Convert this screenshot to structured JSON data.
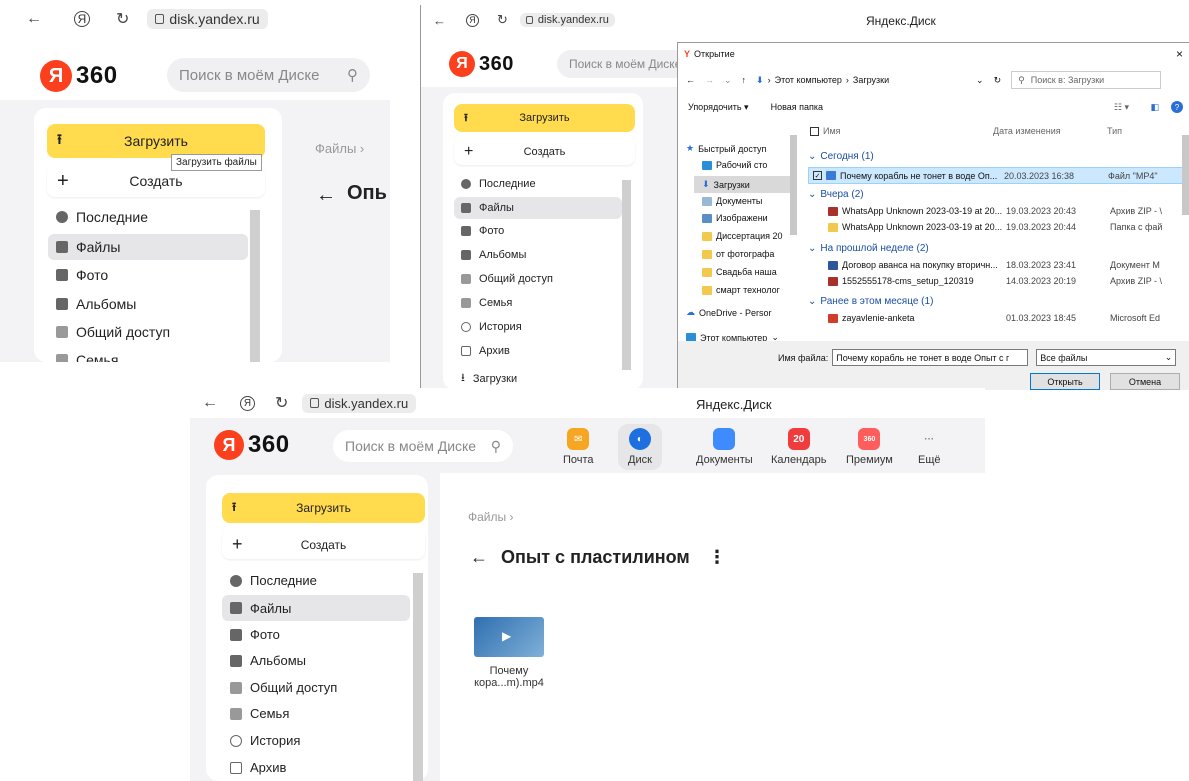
{
  "browser": {
    "url": "disk.yandex.ru",
    "page_title": "Яндекс.Диск"
  },
  "brand": {
    "logo_letter": "Я",
    "logo_text": "360",
    "accent": "#fc3f1d",
    "upload_color": "#ffdb4d"
  },
  "search": {
    "placeholder": "Поиск в моём Диске"
  },
  "sidebar": {
    "upload": "Загрузить",
    "create": "Создать",
    "items": [
      {
        "label": "Последние",
        "icon": "clock-icon"
      },
      {
        "label": "Файлы",
        "icon": "file-icon"
      },
      {
        "label": "Фото",
        "icon": "photo-icon"
      },
      {
        "label": "Альбомы",
        "icon": "album-icon"
      },
      {
        "label": "Общий доступ",
        "icon": "shared-icon"
      },
      {
        "label": "Семья",
        "icon": "family-icon"
      },
      {
        "label": "История",
        "icon": "history-icon"
      },
      {
        "label": "Архив",
        "icon": "archive-icon"
      },
      {
        "label": "Загрузки",
        "icon": "download-icon"
      }
    ]
  },
  "panel1": {
    "tooltip": "Загрузить файлы",
    "breadcrumb": "Файлы",
    "title_partial": "Опь",
    "partial_item": "Семья"
  },
  "dialog": {
    "title": "Открытие",
    "path": [
      "Этот компьютер",
      "Загрузки"
    ],
    "search_placeholder": "Поиск в: Загрузки",
    "organize": "Упорядочить ▾",
    "new_folder": "Новая папка",
    "col_name": "Имя",
    "col_date": "Дата изменения",
    "col_type": "Тип",
    "quick_access": [
      "Быстрый доступ",
      "Рабочий сто",
      "Загрузки",
      "Документы",
      "Изображени",
      "Диссертация 20",
      "от фотографа",
      "Свадьба наша",
      "смарт технолог",
      "OneDrive - Persor",
      "Этот компьютер"
    ],
    "groups": [
      {
        "header": "Сегодня (1)",
        "files": [
          {
            "name": "Почему корабль не тонет в воде Оп...",
            "date": "20.03.2023 16:38",
            "type": "Файл \"MP4\""
          }
        ]
      },
      {
        "header": "Вчера (2)",
        "files": [
          {
            "name": "WhatsApp Unknown 2023-03-19 at 20...",
            "date": "19.03.2023 20:43",
            "type": "Архив ZIP - \\"
          },
          {
            "name": "WhatsApp Unknown 2023-03-19 at 20...",
            "date": "19.03.2023 20:44",
            "type": "Папка с фай"
          }
        ]
      },
      {
        "header": "На прошлой неделе (2)",
        "files": [
          {
            "name": "Договор аванса на покупку вторичн...",
            "date": "18.03.2023 23:41",
            "type": "Документ M"
          },
          {
            "name": "1552555178-cms_setup_120319",
            "date": "14.03.2023 20:19",
            "type": "Архив ZIP - \\"
          }
        ]
      },
      {
        "header": "Ранее в этом месяце (1)",
        "files": [
          {
            "name": "zayavlenie-anketa",
            "date": "01.03.2023 18:45",
            "type": "Microsoft Ed"
          }
        ]
      }
    ],
    "filename_label": "Имя файла:",
    "filename_value": "Почему корабль не тонет в воде Опыт с г",
    "filter": "Все файлы",
    "open": "Открыть",
    "cancel": "Отмена"
  },
  "apps": [
    {
      "label": "Почта",
      "color": "#f5a623",
      "glyph": ""
    },
    {
      "label": "Диск",
      "color": "#1e6fe0",
      "glyph": ""
    },
    {
      "label": "Документы",
      "color": "#3d8bfd",
      "glyph": ""
    },
    {
      "label": "Календарь",
      "color": "#f03c3c",
      "glyph": "20"
    },
    {
      "label": "Премиум",
      "color": "#ff5c5c",
      "glyph": "360"
    },
    {
      "label": "Ещё",
      "color": "",
      "glyph": "···"
    }
  ],
  "main": {
    "breadcrumb": "Файлы",
    "folder_title": "Опыт с пластилином",
    "file_name_line1": "Почему",
    "file_name_line2": "кора...m).mp4"
  }
}
